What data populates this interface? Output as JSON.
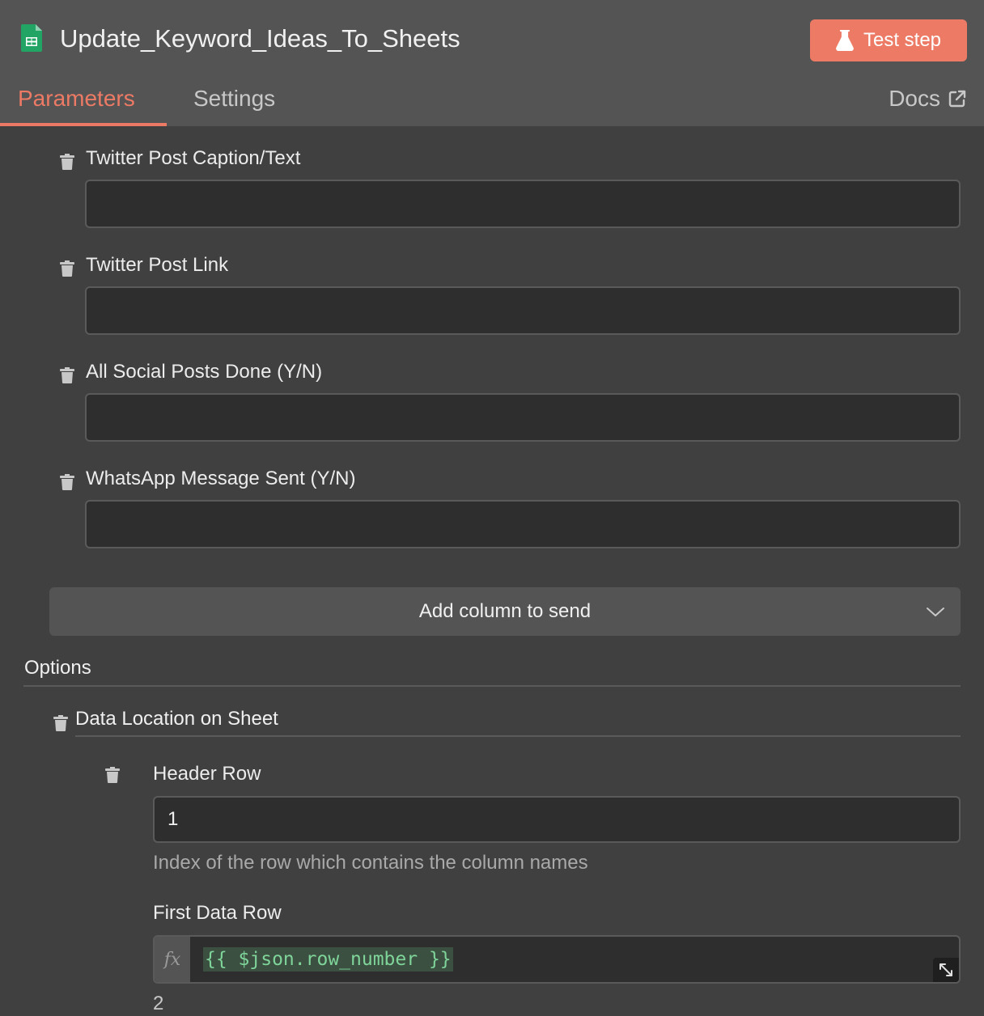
{
  "header": {
    "title": "Update_Keyword_Ideas_To_Sheets",
    "test_step_label": "Test step",
    "tabs": [
      {
        "label": "Parameters",
        "active": true
      },
      {
        "label": "Settings",
        "active": false
      }
    ],
    "docs_label": "Docs",
    "accent_color": "#ec7a65"
  },
  "fields": [
    {
      "label": "Twitter Post Caption/Text",
      "value": ""
    },
    {
      "label": "Twitter Post Link",
      "value": ""
    },
    {
      "label": "All Social Posts Done (Y/N)",
      "value": ""
    },
    {
      "label": "WhatsApp Message Sent (Y/N)",
      "value": ""
    }
  ],
  "add_column": {
    "label": "Add column to send",
    "icon": "chevron-down-icon"
  },
  "options": {
    "title": "Options",
    "data_location": {
      "title": "Data Location on Sheet",
      "header_row": {
        "label": "Header Row",
        "value": "1",
        "hint": "Index of the row which contains the column names"
      },
      "first_data_row": {
        "label": "First Data Row",
        "fx_label": "fx",
        "expression": "{{ $json.row_number }}",
        "preview": "2"
      }
    }
  }
}
